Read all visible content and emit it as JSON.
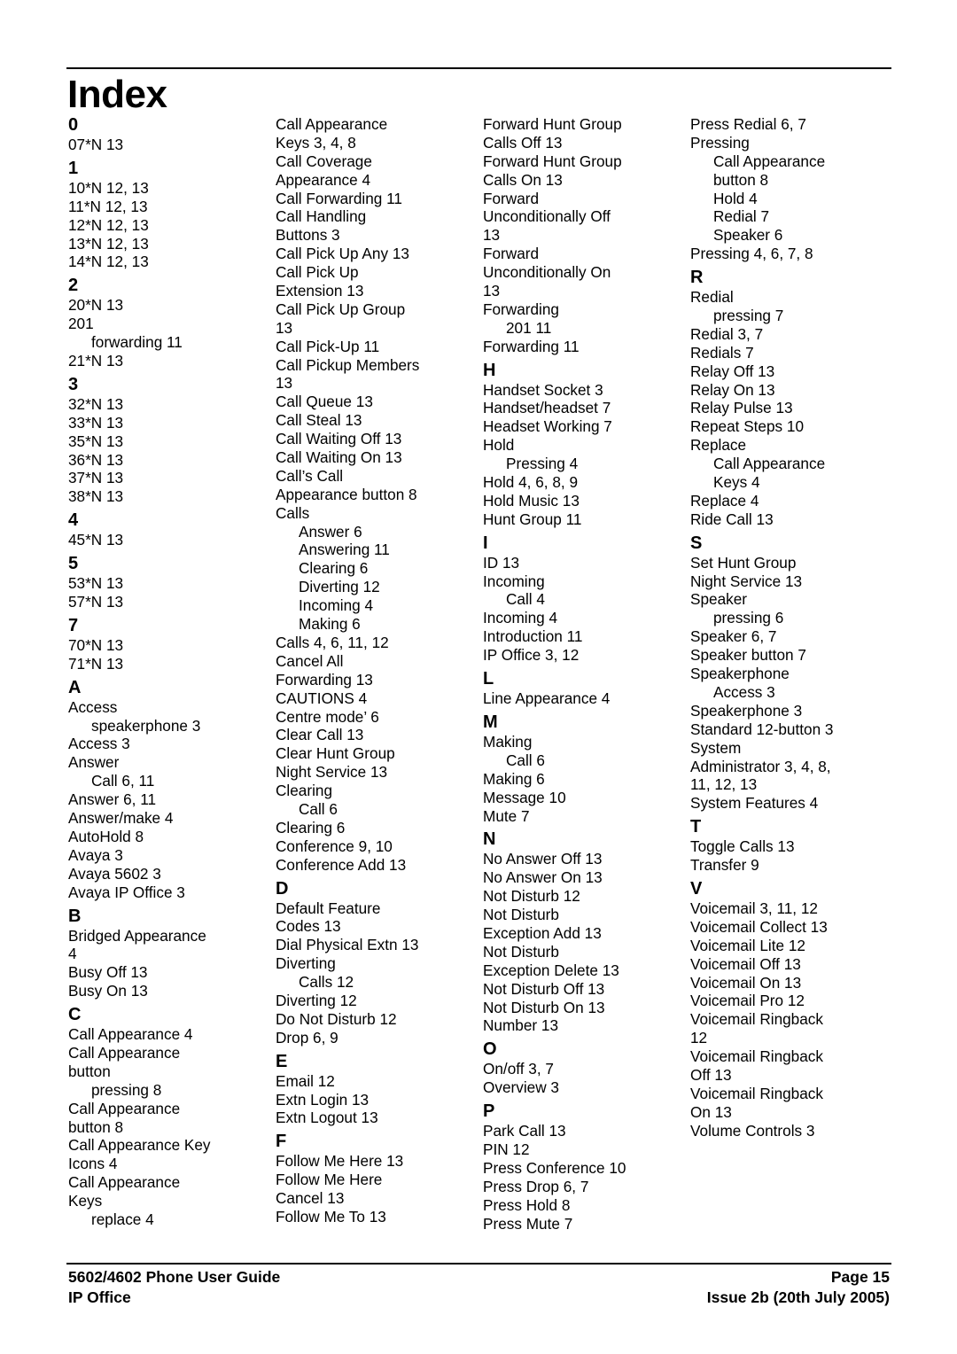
{
  "page": {
    "title": "Index",
    "footer": {
      "left_line1": "5602/4602 Phone User Guide",
      "left_line2": "IP Office",
      "right_line1": "Page 15",
      "right_line2": "Issue 2b (20th July 2005)"
    }
  },
  "columns": [
    [
      {
        "t": "h",
        "text": "0",
        "first": true
      },
      {
        "t": "e",
        "text": "07*N 13"
      },
      {
        "t": "h",
        "text": "1"
      },
      {
        "t": "e",
        "text": "10*N 12, 13"
      },
      {
        "t": "e",
        "text": "11*N 12, 13"
      },
      {
        "t": "e",
        "text": "12*N 12, 13"
      },
      {
        "t": "e",
        "text": "13*N 12, 13"
      },
      {
        "t": "e",
        "text": "14*N 12, 13"
      },
      {
        "t": "h",
        "text": "2"
      },
      {
        "t": "e",
        "text": "20*N 13"
      },
      {
        "t": "e",
        "text": "201"
      },
      {
        "t": "s",
        "text": "forwarding 11"
      },
      {
        "t": "e",
        "text": "21*N 13"
      },
      {
        "t": "h",
        "text": "3"
      },
      {
        "t": "e",
        "text": "32*N 13"
      },
      {
        "t": "e",
        "text": "33*N 13"
      },
      {
        "t": "e",
        "text": "35*N 13"
      },
      {
        "t": "e",
        "text": "36*N 13"
      },
      {
        "t": "e",
        "text": "37*N 13"
      },
      {
        "t": "e",
        "text": "38*N 13"
      },
      {
        "t": "h",
        "text": "4"
      },
      {
        "t": "e",
        "text": "45*N 13"
      },
      {
        "t": "h",
        "text": "5"
      },
      {
        "t": "e",
        "text": "53*N 13"
      },
      {
        "t": "e",
        "text": "57*N 13"
      },
      {
        "t": "h",
        "text": "7"
      },
      {
        "t": "e",
        "text": "70*N 13"
      },
      {
        "t": "e",
        "text": "71*N 13"
      },
      {
        "t": "h",
        "text": "A"
      },
      {
        "t": "e",
        "text": "Access"
      },
      {
        "t": "s",
        "text": "speakerphone 3"
      },
      {
        "t": "e",
        "text": "Access 3"
      },
      {
        "t": "e",
        "text": "Answer"
      },
      {
        "t": "s",
        "text": "Call 6, 11"
      },
      {
        "t": "e",
        "text": "Answer 6, 11"
      },
      {
        "t": "e",
        "text": "Answer/make 4"
      },
      {
        "t": "e",
        "text": "AutoHold 8"
      },
      {
        "t": "e",
        "text": "Avaya 3"
      },
      {
        "t": "e",
        "text": "Avaya 5602 3"
      },
      {
        "t": "e",
        "text": "Avaya IP Office 3"
      },
      {
        "t": "h",
        "text": "B"
      },
      {
        "t": "e",
        "text": "Bridged Appearance"
      },
      {
        "t": "e",
        "text": "4"
      },
      {
        "t": "e",
        "text": "Busy Off 13"
      },
      {
        "t": "e",
        "text": "Busy On 13"
      },
      {
        "t": "h",
        "text": "C"
      },
      {
        "t": "e",
        "text": "Call Appearance 4"
      },
      {
        "t": "e",
        "text": "Call Appearance"
      },
      {
        "t": "e",
        "text": "button"
      },
      {
        "t": "s",
        "text": "pressing 8"
      },
      {
        "t": "e",
        "text": "Call Appearance"
      },
      {
        "t": "e",
        "text": "button 8"
      },
      {
        "t": "e",
        "text": "Call Appearance Key"
      },
      {
        "t": "e",
        "text": "Icons 4"
      },
      {
        "t": "e",
        "text": "Call Appearance"
      },
      {
        "t": "e",
        "text": "Keys"
      },
      {
        "t": "s",
        "text": "replace 4"
      }
    ],
    [
      {
        "t": "e",
        "text": "Call Appearance"
      },
      {
        "t": "e",
        "text": "Keys 3, 4, 8"
      },
      {
        "t": "e",
        "text": "Call Coverage"
      },
      {
        "t": "e",
        "text": "Appearance 4"
      },
      {
        "t": "e",
        "text": "Call Forwarding 11"
      },
      {
        "t": "e",
        "text": "Call Handling"
      },
      {
        "t": "e",
        "text": "Buttons 3"
      },
      {
        "t": "e",
        "text": "Call Pick Up Any 13"
      },
      {
        "t": "e",
        "text": "Call Pick Up"
      },
      {
        "t": "e",
        "text": "Extension 13"
      },
      {
        "t": "e",
        "text": "Call Pick Up Group"
      },
      {
        "t": "e",
        "text": "13"
      },
      {
        "t": "e",
        "text": "Call Pick-Up 11"
      },
      {
        "t": "e",
        "text": "Call Pickup Members"
      },
      {
        "t": "e",
        "text": "13"
      },
      {
        "t": "e",
        "text": "Call Queue 13"
      },
      {
        "t": "e",
        "text": "Call Steal 13"
      },
      {
        "t": "e",
        "text": "Call Waiting Off 13"
      },
      {
        "t": "e",
        "text": "Call Waiting On 13"
      },
      {
        "t": "e",
        "text": "Call’s Call"
      },
      {
        "t": "e",
        "text": "Appearance button 8"
      },
      {
        "t": "e",
        "text": "Calls"
      },
      {
        "t": "s",
        "text": "Answer 6"
      },
      {
        "t": "s",
        "text": "Answering 11"
      },
      {
        "t": "s",
        "text": "Clearing 6"
      },
      {
        "t": "s",
        "text": "Diverting 12"
      },
      {
        "t": "s",
        "text": "Incoming 4"
      },
      {
        "t": "s",
        "text": "Making 6"
      },
      {
        "t": "e",
        "text": "Calls 4, 6, 11, 12"
      },
      {
        "t": "e",
        "text": "Cancel All"
      },
      {
        "t": "e",
        "text": "Forwarding 13"
      },
      {
        "t": "e",
        "text": "CAUTIONS 4"
      },
      {
        "t": "e",
        "text": "Centre mode’ 6"
      },
      {
        "t": "e",
        "text": "Clear Call 13"
      },
      {
        "t": "e",
        "text": "Clear Hunt Group"
      },
      {
        "t": "e",
        "text": "Night Service 13"
      },
      {
        "t": "e",
        "text": "Clearing"
      },
      {
        "t": "s",
        "text": "Call 6"
      },
      {
        "t": "e",
        "text": "Clearing 6"
      },
      {
        "t": "e",
        "text": "Conference 9, 10"
      },
      {
        "t": "e",
        "text": "Conference Add 13"
      },
      {
        "t": "h",
        "text": "D"
      },
      {
        "t": "e",
        "text": "Default Feature"
      },
      {
        "t": "e",
        "text": "Codes 13"
      },
      {
        "t": "e",
        "text": "Dial Physical Extn 13"
      },
      {
        "t": "e",
        "text": "Diverting"
      },
      {
        "t": "s",
        "text": "Calls 12"
      },
      {
        "t": "e",
        "text": "Diverting 12"
      },
      {
        "t": "e",
        "text": "Do Not Disturb 12"
      },
      {
        "t": "e",
        "text": "Drop 6, 9"
      },
      {
        "t": "h",
        "text": "E"
      },
      {
        "t": "e",
        "text": "Email 12"
      },
      {
        "t": "e",
        "text": "Extn Login 13"
      },
      {
        "t": "e",
        "text": "Extn Logout 13"
      },
      {
        "t": "h",
        "text": "F"
      },
      {
        "t": "e",
        "text": "Follow Me Here 13"
      },
      {
        "t": "e",
        "text": "Follow Me Here"
      },
      {
        "t": "e",
        "text": "Cancel 13"
      },
      {
        "t": "e",
        "text": "Follow Me To 13"
      }
    ],
    [
      {
        "t": "e",
        "text": "Forward Hunt Group"
      },
      {
        "t": "e",
        "text": "Calls Off 13"
      },
      {
        "t": "e",
        "text": "Forward Hunt Group"
      },
      {
        "t": "e",
        "text": "Calls On 13"
      },
      {
        "t": "e",
        "text": "Forward"
      },
      {
        "t": "e",
        "text": "Unconditionally Off"
      },
      {
        "t": "e",
        "text": "13"
      },
      {
        "t": "e",
        "text": "Forward"
      },
      {
        "t": "e",
        "text": "Unconditionally On"
      },
      {
        "t": "e",
        "text": "13"
      },
      {
        "t": "e",
        "text": "Forwarding"
      },
      {
        "t": "s",
        "text": "201 11"
      },
      {
        "t": "e",
        "text": "Forwarding 11"
      },
      {
        "t": "h",
        "text": "H"
      },
      {
        "t": "e",
        "text": "Handset Socket 3"
      },
      {
        "t": "e",
        "text": "Handset/headset 7"
      },
      {
        "t": "e",
        "text": "Headset Working 7"
      },
      {
        "t": "e",
        "text": "Hold"
      },
      {
        "t": "s",
        "text": "Pressing 4"
      },
      {
        "t": "e",
        "text": "Hold 4, 6, 8, 9"
      },
      {
        "t": "e",
        "text": "Hold Music 13"
      },
      {
        "t": "e",
        "text": "Hunt Group 11"
      },
      {
        "t": "h",
        "text": "I"
      },
      {
        "t": "e",
        "text": "ID 13"
      },
      {
        "t": "e",
        "text": "Incoming"
      },
      {
        "t": "s",
        "text": "Call 4"
      },
      {
        "t": "e",
        "text": "Incoming 4"
      },
      {
        "t": "e",
        "text": "Introduction 11"
      },
      {
        "t": "e",
        "text": "IP Office 3, 12"
      },
      {
        "t": "h",
        "text": "L"
      },
      {
        "t": "e",
        "text": "Line Appearance 4"
      },
      {
        "t": "h",
        "text": "M"
      },
      {
        "t": "e",
        "text": "Making"
      },
      {
        "t": "s",
        "text": "Call 6"
      },
      {
        "t": "e",
        "text": "Making 6"
      },
      {
        "t": "e",
        "text": "Message 10"
      },
      {
        "t": "e",
        "text": "Mute 7"
      },
      {
        "t": "h",
        "text": "N"
      },
      {
        "t": "e",
        "text": "No Answer Off 13"
      },
      {
        "t": "e",
        "text": "No Answer On 13"
      },
      {
        "t": "e",
        "text": "Not Disturb 12"
      },
      {
        "t": "e",
        "text": "Not Disturb"
      },
      {
        "t": "e",
        "text": "Exception Add 13"
      },
      {
        "t": "e",
        "text": "Not Disturb"
      },
      {
        "t": "e",
        "text": "Exception Delete 13"
      },
      {
        "t": "e",
        "text": "Not Disturb Off 13"
      },
      {
        "t": "e",
        "text": "Not Disturb On 13"
      },
      {
        "t": "e",
        "text": "Number 13"
      },
      {
        "t": "h",
        "text": "O"
      },
      {
        "t": "e",
        "text": "On/off 3, 7"
      },
      {
        "t": "e",
        "text": "Overview 3"
      },
      {
        "t": "h",
        "text": "P"
      },
      {
        "t": "e",
        "text": "Park Call 13"
      },
      {
        "t": "e",
        "text": "PIN 12"
      },
      {
        "t": "e",
        "text": "Press Conference 10"
      },
      {
        "t": "e",
        "text": "Press Drop 6, 7"
      },
      {
        "t": "e",
        "text": "Press Hold 8"
      },
      {
        "t": "e",
        "text": "Press Mute 7"
      }
    ],
    [
      {
        "t": "e",
        "text": "Press Redial 6, 7"
      },
      {
        "t": "e",
        "text": "Pressing"
      },
      {
        "t": "s",
        "text": "Call Appearance"
      },
      {
        "t": "s",
        "text": "button 8"
      },
      {
        "t": "s",
        "text": "Hold 4"
      },
      {
        "t": "s",
        "text": "Redial 7"
      },
      {
        "t": "s",
        "text": "Speaker 6"
      },
      {
        "t": "e",
        "text": "Pressing 4, 6, 7, 8"
      },
      {
        "t": "h",
        "text": "R"
      },
      {
        "t": "e",
        "text": "Redial"
      },
      {
        "t": "s",
        "text": "pressing 7"
      },
      {
        "t": "e",
        "text": "Redial 3, 7"
      },
      {
        "t": "e",
        "text": "Redials 7"
      },
      {
        "t": "e",
        "text": "Relay Off 13"
      },
      {
        "t": "e",
        "text": "Relay On 13"
      },
      {
        "t": "e",
        "text": "Relay Pulse 13"
      },
      {
        "t": "e",
        "text": "Repeat Steps 10"
      },
      {
        "t": "e",
        "text": "Replace"
      },
      {
        "t": "s",
        "text": "Call Appearance"
      },
      {
        "t": "s",
        "text": "Keys 4"
      },
      {
        "t": "e",
        "text": "Replace 4"
      },
      {
        "t": "e",
        "text": "Ride Call 13"
      },
      {
        "t": "h",
        "text": "S"
      },
      {
        "t": "e",
        "text": "Set Hunt Group"
      },
      {
        "t": "e",
        "text": "Night Service 13"
      },
      {
        "t": "e",
        "text": "Speaker"
      },
      {
        "t": "s",
        "text": "pressing 6"
      },
      {
        "t": "e",
        "text": "Speaker 6, 7"
      },
      {
        "t": "e",
        "text": "Speaker button 7"
      },
      {
        "t": "e",
        "text": "Speakerphone"
      },
      {
        "t": "s",
        "text": "Access 3"
      },
      {
        "t": "e",
        "text": "Speakerphone 3"
      },
      {
        "t": "e",
        "text": "Standard 12-button 3"
      },
      {
        "t": "e",
        "text": "System"
      },
      {
        "t": "e",
        "text": "Administrator 3, 4, 8,"
      },
      {
        "t": "e",
        "text": "11, 12, 13"
      },
      {
        "t": "e",
        "text": "System Features 4"
      },
      {
        "t": "h",
        "text": "T"
      },
      {
        "t": "e",
        "text": "Toggle Calls 13"
      },
      {
        "t": "e",
        "text": "Transfer 9"
      },
      {
        "t": "h",
        "text": "V"
      },
      {
        "t": "e",
        "text": "Voicemail 3, 11, 12"
      },
      {
        "t": "e",
        "text": "Voicemail Collect 13"
      },
      {
        "t": "e",
        "text": "Voicemail Lite 12"
      },
      {
        "t": "e",
        "text": "Voicemail Off 13"
      },
      {
        "t": "e",
        "text": "Voicemail On 13"
      },
      {
        "t": "e",
        "text": "Voicemail Pro 12"
      },
      {
        "t": "e",
        "text": "Voicemail Ringback"
      },
      {
        "t": "e",
        "text": "12"
      },
      {
        "t": "e",
        "text": "Voicemail Ringback"
      },
      {
        "t": "e",
        "text": "Off 13"
      },
      {
        "t": "e",
        "text": "Voicemail Ringback"
      },
      {
        "t": "e",
        "text": "On 13"
      },
      {
        "t": "e",
        "text": "Volume Controls 3"
      }
    ]
  ]
}
